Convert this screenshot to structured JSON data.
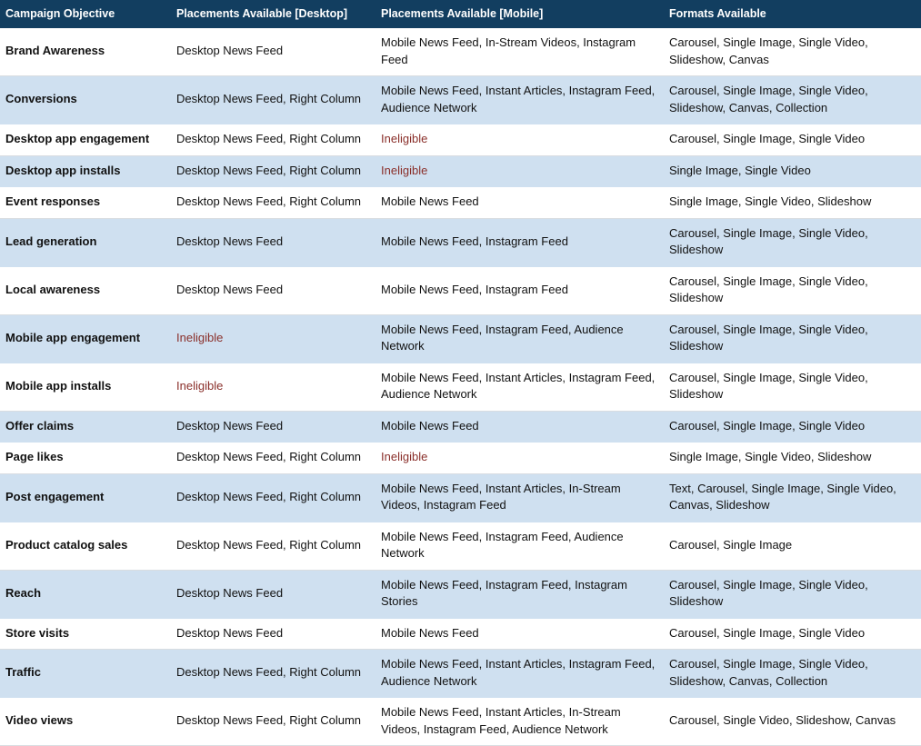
{
  "table": {
    "headers": [
      "Campaign Objective",
      "Placements Available [Desktop]",
      "Placements Available [Mobile]",
      "Formats Available"
    ],
    "colors": {
      "header_background": "#123E60",
      "header_text": "#FFFFFF",
      "row_alt_background": "#CFE0F0",
      "row_background": "#FFFFFF",
      "ineligible_text": "#8A2F2A",
      "body_text": "#111111"
    },
    "ineligible_label": "Ineligible",
    "rows": [
      {
        "objective": "Brand Awareness",
        "desktop": "Desktop News Feed",
        "mobile": "Mobile News Feed, In-Stream Videos, Instagram Feed",
        "formats": "Carousel, Single Image, Single Video, Slideshow, Canvas"
      },
      {
        "objective": "Conversions",
        "desktop": "Desktop News Feed, Right Column",
        "mobile": "Mobile News Feed, Instant Articles, Instagram Feed, Audience Network",
        "formats": "Carousel, Single Image, Single Video, Slideshow, Canvas, Collection"
      },
      {
        "objective": "Desktop app engagement",
        "desktop": "Desktop News Feed, Right Column",
        "mobile": "Ineligible",
        "formats": "Carousel, Single Image, Single Video"
      },
      {
        "objective": "Desktop app installs",
        "desktop": "Desktop News Feed, Right Column",
        "mobile": "Ineligible",
        "formats": "Single Image, Single Video"
      },
      {
        "objective": "Event responses",
        "desktop": "Desktop News Feed, Right Column",
        "mobile": "Mobile News Feed",
        "formats": "Single Image, Single Video, Slideshow"
      },
      {
        "objective": "Lead generation",
        "desktop": "Desktop News Feed",
        "mobile": "Mobile News Feed, Instagram Feed",
        "formats": "Carousel, Single Image, Single Video, Slideshow"
      },
      {
        "objective": "Local awareness",
        "desktop": "Desktop News Feed",
        "mobile": "Mobile News Feed, Instagram Feed",
        "formats": "Carousel, Single Image, Single Video, Slideshow"
      },
      {
        "objective": "Mobile app engagement",
        "desktop": "Ineligible",
        "mobile": "Mobile News Feed, Instagram Feed, Audience Network",
        "formats": "Carousel, Single Image, Single Video, Slideshow"
      },
      {
        "objective": "Mobile app installs",
        "desktop": "Ineligible",
        "mobile": "Mobile News Feed, Instant Articles, Instagram Feed, Audience Network",
        "formats": "Carousel, Single Image, Single Video, Slideshow"
      },
      {
        "objective": "Offer claims",
        "desktop": "Desktop News Feed",
        "mobile": "Mobile News Feed",
        "formats": "Carousel, Single Image, Single Video"
      },
      {
        "objective": "Page likes",
        "desktop": "Desktop News Feed, Right Column",
        "mobile": "Ineligible",
        "formats": "Single Image, Single Video, Slideshow"
      },
      {
        "objective": "Post engagement",
        "desktop": "Desktop News Feed, Right Column",
        "mobile": "Mobile News Feed, Instant Articles, In-Stream Videos, Instagram Feed",
        "formats": "Text, Carousel, Single Image, Single Video, Canvas, Slideshow"
      },
      {
        "objective": "Product catalog sales",
        "desktop": "Desktop News Feed, Right Column",
        "mobile": "Mobile News Feed, Instagram Feed, Audience Network",
        "formats": "Carousel, Single Image"
      },
      {
        "objective": "Reach",
        "desktop": "Desktop News Feed",
        "mobile": "Mobile News Feed, Instagram Feed, Instagram Stories",
        "formats": "Carousel, Single Image, Single Video, Slideshow"
      },
      {
        "objective": "Store visits",
        "desktop": "Desktop News Feed",
        "mobile": "Mobile News Feed",
        "formats": "Carousel, Single Image, Single Video"
      },
      {
        "objective": "Traffic",
        "desktop": "Desktop News Feed, Right Column",
        "mobile": "Mobile News Feed, Instant Articles, Instagram Feed, Audience Network",
        "formats": "Carousel, Single Image, Single Video, Slideshow, Canvas, Collection"
      },
      {
        "objective": "Video views",
        "desktop": "Desktop News Feed, Right Column",
        "mobile": "Mobile News Feed, Instant Articles, In-Stream Videos, Instagram Feed, Audience Network",
        "formats": "Carousel, Single Video, Slideshow, Canvas"
      }
    ]
  }
}
